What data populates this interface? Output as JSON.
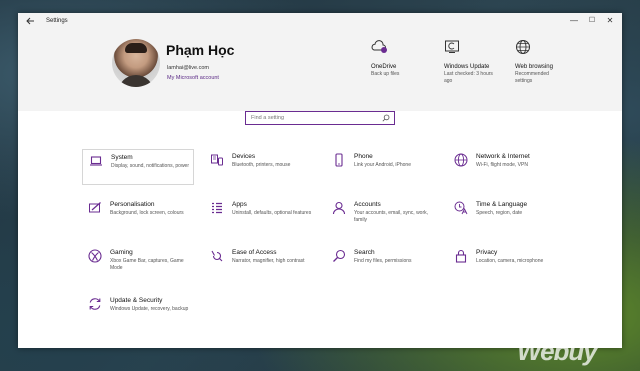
{
  "window": {
    "title": "Settings",
    "back_icon": "back-arrow-icon",
    "controls": {
      "minimize": "—",
      "maximize": "☐",
      "close": "✕"
    }
  },
  "profile": {
    "name": "Phạm Học",
    "email": "lamhai@live.com",
    "account_link": "My Microsoft account"
  },
  "quick_links": [
    {
      "title": "OneDrive",
      "subtitle": "Back up files",
      "icon": "onedrive-icon"
    },
    {
      "title": "Windows Update",
      "subtitle": "Last checked: 3 hours ago",
      "icon": "windows-update-icon"
    },
    {
      "title": "Web browsing",
      "subtitle": "Recommended settings",
      "icon": "globe-icon"
    }
  ],
  "search": {
    "placeholder": "Find a setting"
  },
  "categories": [
    {
      "name": "System",
      "desc": "Display, sound, notifications, power",
      "icon": "laptop-icon"
    },
    {
      "name": "Devices",
      "desc": "Bluetooth, printers, mouse",
      "icon": "devices-icon"
    },
    {
      "name": "Phone",
      "desc": "Link your Android, iPhone",
      "icon": "phone-icon"
    },
    {
      "name": "Network & Internet",
      "desc": "Wi-Fi, flight mode, VPN",
      "icon": "globe-icon"
    },
    {
      "name": "Personalisation",
      "desc": "Background, lock screen, colours",
      "icon": "personalisation-icon"
    },
    {
      "name": "Apps",
      "desc": "Uninstall, defaults, optional features",
      "icon": "apps-icon"
    },
    {
      "name": "Accounts",
      "desc": "Your accounts, email, sync, work, family",
      "icon": "person-icon"
    },
    {
      "name": "Time & Language",
      "desc": "Speech, region, date",
      "icon": "time-language-icon"
    },
    {
      "name": "Gaming",
      "desc": "Xbox Game Bar, captures, Game Mode",
      "icon": "xbox-icon"
    },
    {
      "name": "Ease of Access",
      "desc": "Narrator, magnifier, high contrast",
      "icon": "ease-of-access-icon"
    },
    {
      "name": "Search",
      "desc": "Find my files, permissions",
      "icon": "search-icon"
    },
    {
      "name": "Privacy",
      "desc": "Location, camera, microphone",
      "icon": "lock-icon"
    },
    {
      "name": "Update & Security",
      "desc": "Windows Update, recovery, backup",
      "icon": "update-icon"
    }
  ],
  "watermark": "Webuy",
  "colors": {
    "accent": "#6a2c91",
    "header_bg": "#f3f3f3"
  }
}
